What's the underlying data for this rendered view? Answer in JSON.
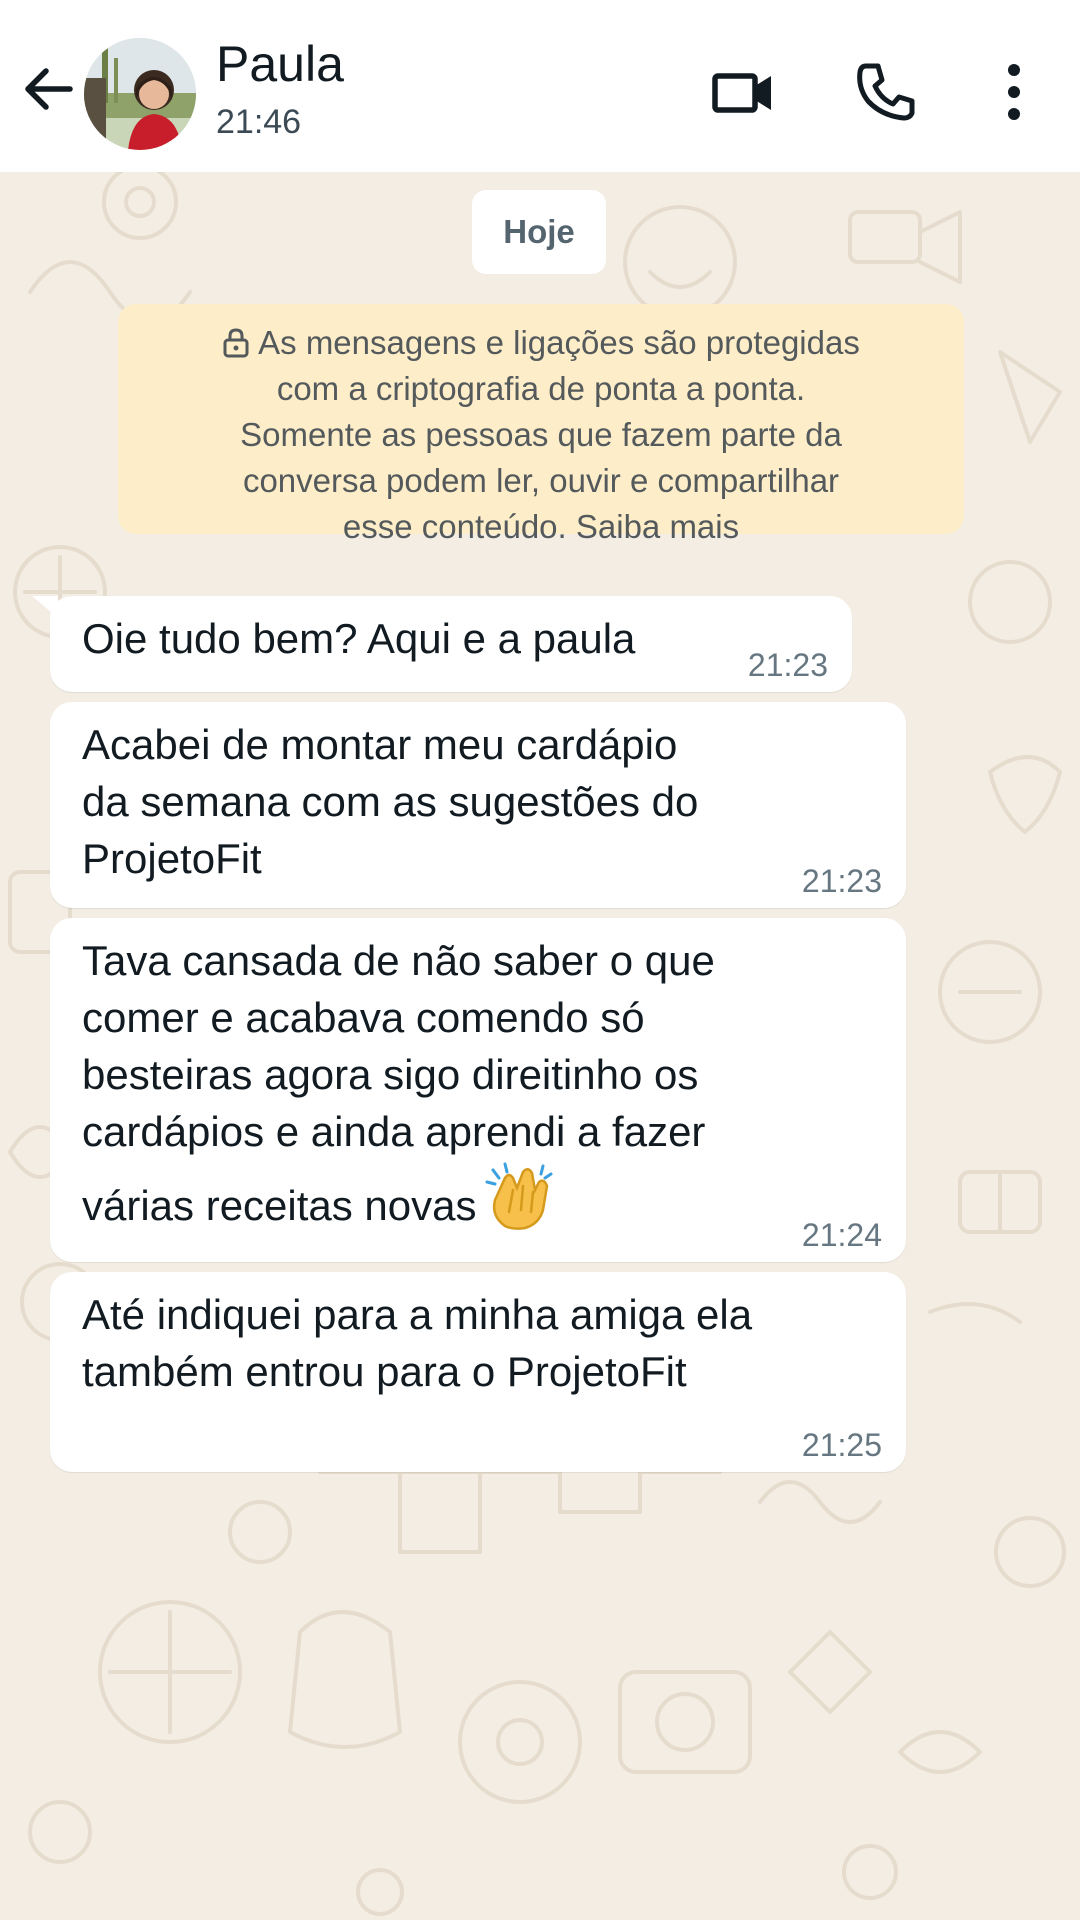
{
  "header": {
    "contact_name": "Paula",
    "status": "21:46",
    "icons": {
      "back": "arrow-back-icon",
      "video": "video-call-icon",
      "call": "phone-icon",
      "menu": "more-vert-icon"
    }
  },
  "chat": {
    "date_label": "Hoje",
    "encryption_notice": "As mensagens e ligações são protegidas\ncom a criptografia de ponta a ponta.\nSomente as pessoas que fazem parte da\nconversa podem ler, ouvir e compartilhar\nesse conteúdo. Saiba mais",
    "messages": [
      {
        "text": "Oie tudo bem? Aqui e a paula",
        "time": "21:23"
      },
      {
        "text": "Acabei de montar meu cardápio\nda semana com as sugestões do\nProjetoFit",
        "time": "21:23"
      },
      {
        "text": "Tava cansada de não saber o que\ncomer e acabava comendo só\nbesteiras agora sigo direitinho os\ncardápios e ainda aprendi a fazer\nvárias receitas novas",
        "emoji": "clapping-hands-icon",
        "time": "21:24"
      },
      {
        "text": "Até indiquei para a minha amiga ela\ntambém entrou para o ProjetoFit",
        "time": "21:25"
      }
    ]
  },
  "colors": {
    "header_bg": "#ffffff",
    "chat_bg": "#f3ede4",
    "bubble_bg": "#ffffff",
    "notice_bg": "#fdeec9",
    "text_primary": "#111b21",
    "text_secondary": "#667781"
  }
}
